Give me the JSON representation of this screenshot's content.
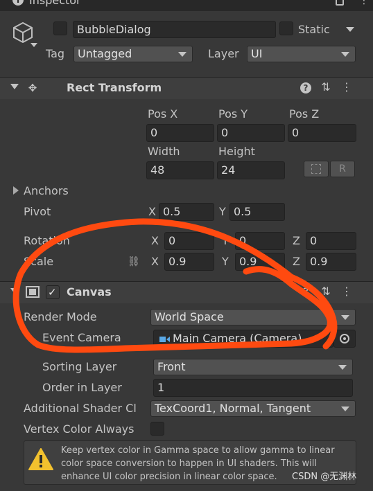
{
  "window": {
    "tab_title": "Inspector"
  },
  "object": {
    "name": "BubbleDialog",
    "static_label": "Static",
    "tag_label": "Tag",
    "tag_value": "Untagged",
    "layer_label": "Layer",
    "layer_value": "UI"
  },
  "rect_transform": {
    "title": "Rect Transform",
    "pos_x_label": "Pos X",
    "pos_y_label": "Pos Y",
    "pos_z_label": "Pos Z",
    "pos_x": "0",
    "pos_y": "0",
    "pos_z": "0",
    "width_label": "Width",
    "height_label": "Height",
    "width": "48",
    "height": "24",
    "r_button": "R",
    "anchors_label": "Anchors",
    "pivot_label": "Pivot",
    "pivot_x_label": "X",
    "pivot_x": "0.5",
    "pivot_y_label": "Y",
    "pivot_y": "0.5",
    "rotation_label": "Rotation",
    "rot_x_label": "X",
    "rot_x": "0",
    "rot_y_label": "Y",
    "rot_y": "0",
    "rot_z_label": "Z",
    "rot_z": "0",
    "scale_label": "Scale",
    "scale_x_label": "X",
    "scale_x": "0.9",
    "scale_y_label": "Y",
    "scale_y": "0.9",
    "scale_z_label": "Z",
    "scale_z": "0.9"
  },
  "canvas": {
    "title": "Canvas",
    "render_mode_label": "Render Mode",
    "render_mode_value": "World Space",
    "event_camera_label": "Event Camera",
    "event_camera_value": "Main Camera (Camera)",
    "sorting_layer_label": "Sorting Layer",
    "sorting_layer_value": "Front",
    "order_in_layer_label": "Order in Layer",
    "order_in_layer_value": "1",
    "additional_shader_label": "Additional Shader Cl",
    "additional_shader_value": "TexCoord1, Normal, Tangent",
    "vertex_color_label": "Vertex Color Always",
    "warning_text": "Keep vertex color in Gamma space to allow gamma to linear color space conversion to happen in UI shaders. This will enhance UI color precision in linear color space."
  },
  "watermark": "CSDN @无渊林",
  "colors": {
    "background": "#383838",
    "annotation": "#ff4a10",
    "warning": "#f2c12e"
  }
}
